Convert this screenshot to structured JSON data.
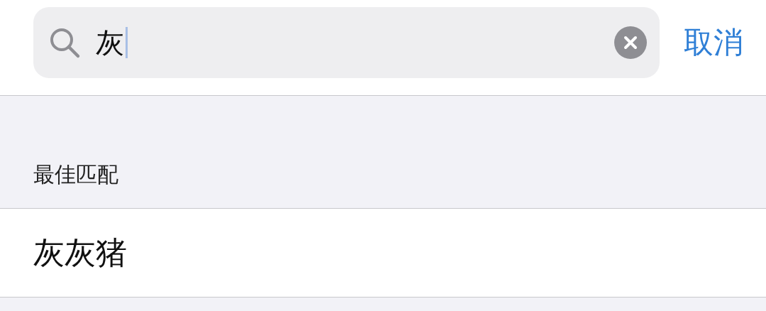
{
  "search": {
    "value": "灰"
  },
  "cancel_button": "取消",
  "sections": [
    {
      "header": "最佳匹配",
      "rows": [
        {
          "title": "灰灰猪"
        }
      ]
    }
  ]
}
